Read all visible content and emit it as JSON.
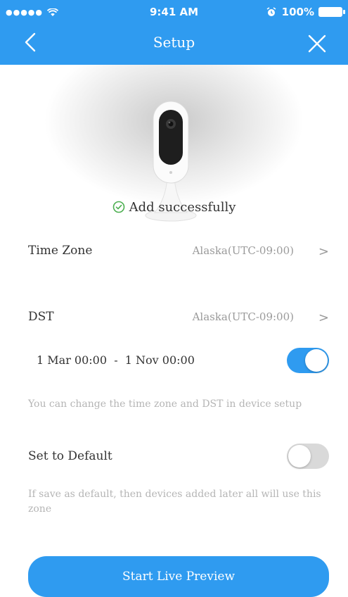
{
  "status_bar": {
    "signal_dots": "●●●●●",
    "time": "9:41 AM",
    "battery_percent": "100%",
    "battery_level": 1.0
  },
  "nav": {
    "title": "Setup",
    "back_icon": "chevron-left-icon",
    "close_icon": "close-icon"
  },
  "device": {
    "image": "camera-image",
    "success_icon": "check-circle-icon",
    "success_text": "Add successfully"
  },
  "settings": {
    "time_zone": {
      "label": "Time Zone",
      "value": "Alaska(UTC-09:00)",
      "chevron": ">"
    },
    "dst": {
      "label": "DST",
      "value": "Alaska(UTC-09:00)",
      "chevron": ">"
    },
    "dst_range": {
      "label": "1 Mar 00:00  -  1 Nov 00:00",
      "enabled": true
    },
    "hint_timezone": "You can change the time zone and DST in device setup",
    "set_default": {
      "label": "Set to Default",
      "enabled": false
    },
    "hint_default": "If save as default, then devices added later all will use this zone"
  },
  "actions": {
    "start_preview": "Start Live Preview"
  },
  "colors": {
    "accent": "#2f9bf0",
    "success": "#4caf50",
    "toggle_off": "#d9d9d9"
  }
}
